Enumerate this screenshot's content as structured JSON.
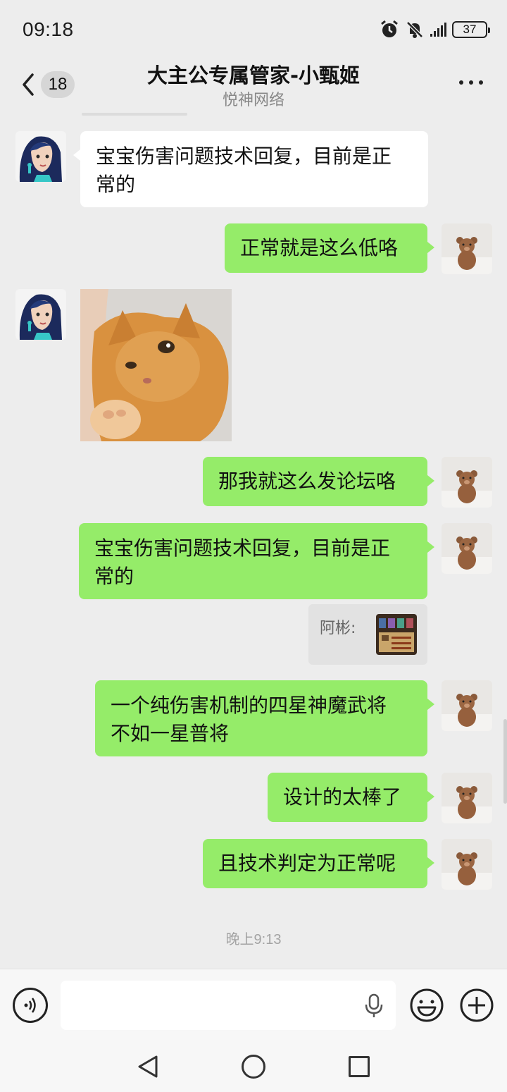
{
  "status_bar": {
    "time": "09:18",
    "battery": "37",
    "icons": [
      "alarm-icon",
      "mute-icon",
      "signal-icon",
      "battery-icon"
    ]
  },
  "header": {
    "back_badge": "18",
    "title": "大主公专属管家-小甄姬",
    "subtitle": "悦神网络",
    "more_icon": "more-icon"
  },
  "messages": [
    {
      "sender": "other",
      "type": "text",
      "lines": [
        "宝宝伤害问题技术回复，目前是正",
        "常的"
      ]
    },
    {
      "sender": "me",
      "type": "text",
      "lines": [
        "正常就是这么低咯"
      ]
    },
    {
      "sender": "other",
      "type": "image",
      "image": "orange-cat-photo"
    },
    {
      "sender": "me",
      "type": "text",
      "lines": [
        "那我就这么发论坛咯"
      ]
    },
    {
      "sender": "me",
      "type": "text",
      "lines": [
        "宝宝伤害问题技术回复，目前是正",
        "常的"
      ]
    },
    {
      "sender": "me",
      "type": "quote",
      "quote_author": "阿彬:",
      "quote_thumb": "game-screenshot-thumb"
    },
    {
      "sender": "me",
      "type": "text",
      "lines": [
        "一个纯伤害机制的四星神魔武将",
        "不如一星普将"
      ]
    },
    {
      "sender": "me",
      "type": "text",
      "lines": [
        "设计的太棒了"
      ]
    },
    {
      "sender": "me",
      "type": "text",
      "lines": [
        "且技术判定为正常呢"
      ]
    }
  ],
  "timestamp": "晚上9:13",
  "input_bar": {
    "voice_icon": "voice-icon",
    "text_value": "",
    "mic_icon": "mic-icon",
    "emoji_icon": "emoji-icon",
    "plus_icon": "plus-icon"
  },
  "nav_bar": {
    "icons": [
      "nav-back-icon",
      "nav-home-icon",
      "nav-recent-icon"
    ]
  },
  "colors": {
    "background": "#ededed",
    "my_bubble": "#95ec69",
    "other_bubble": "#ffffff"
  }
}
